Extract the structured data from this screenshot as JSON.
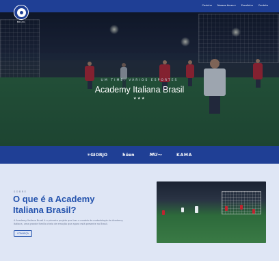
{
  "header": {
    "logo_text": "BRASIL",
    "nav": [
      "Cozinha",
      "Nossas times",
      "Escolinha",
      "Contato"
    ],
    "nav_dropdown_index": 1
  },
  "hero": {
    "subtitle": "UM TIME. VÁRIOS ESPORTES",
    "title": "Academy Italiana Brasil",
    "stars": "★★★"
  },
  "sponsors": [
    "GIORJO",
    "hüen",
    "MU",
    "KAMA"
  ],
  "about": {
    "kicker": "SOBRE",
    "title": "O que é a Academy Italiana Brasil?",
    "body": "A Academy Italiana Brasil é o primeiro projeto que traz o modelo de metodologia da Academy Italiana, uma grande família cheia de emoção que agora está presente no Brasil.",
    "button": "CONHEÇA"
  },
  "colors": {
    "brand_blue": "#1f3f95",
    "accent_blue": "#2453ad",
    "section_bg": "#dfe6f5"
  }
}
